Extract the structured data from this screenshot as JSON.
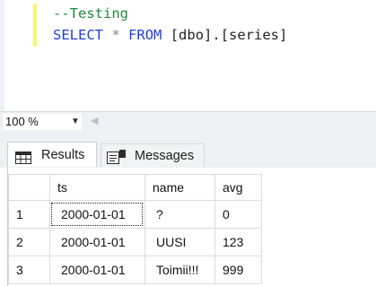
{
  "editor": {
    "lines": [
      {
        "comment": "--Testing"
      },
      {
        "kw1": "SELECT",
        "star": "*",
        "kw2": "FROM",
        "rest": "[dbo].[series]"
      }
    ]
  },
  "statusbar": {
    "zoom_value": "100 %"
  },
  "tabs": [
    {
      "label": "Results",
      "icon": "grid-icon",
      "active": true
    },
    {
      "label": "Messages",
      "icon": "messages-icon",
      "active": false
    }
  ],
  "grid": {
    "columns": [
      "ts",
      "name",
      "avg"
    ],
    "rows": [
      {
        "num": "1",
        "ts": "2000-01-01",
        "name": "?",
        "avg": "0"
      },
      {
        "num": "2",
        "ts": "2000-01-01",
        "name": "UUSI",
        "avg": "123"
      },
      {
        "num": "3",
        "ts": "2000-01-01",
        "name": "Toimii!!!",
        "avg": "999"
      }
    ]
  },
  "colors": {
    "keyword": "#1c3de6",
    "comment": "#1e8a3a",
    "change_bar": "#fff271"
  }
}
